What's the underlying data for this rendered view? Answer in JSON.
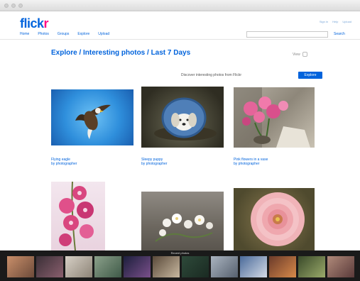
{
  "header": {
    "logo_main": "flickr",
    "logo_tag": "",
    "nav": [
      "Home",
      "Photos",
      "Groups",
      "Explore",
      "Upload"
    ],
    "top_links": [
      "Sign in",
      "Help",
      "Upload"
    ],
    "search_placeholder": "",
    "search_label": "Search"
  },
  "page": {
    "title": "Explore / Interesting photos / Last 7 Days",
    "view_label": "View"
  },
  "promo": {
    "text": "Discover interesting photos from Flickr",
    "button_label": "Explore"
  },
  "photos": [
    {
      "title": "Flying eagle",
      "author": "by photographer"
    },
    {
      "title": "Sleepy puppy",
      "author": "by photographer"
    },
    {
      "title": "Pink flowers in a vase",
      "author": "by photographer"
    },
    {
      "title": "",
      "author": ""
    },
    {
      "title": "",
      "author": ""
    },
    {
      "title": "",
      "author": ""
    }
  ],
  "strip": {
    "label": "Recent photos"
  },
  "colors": {
    "brand_blue": "#0063dc",
    "brand_pink": "#ff0084"
  }
}
